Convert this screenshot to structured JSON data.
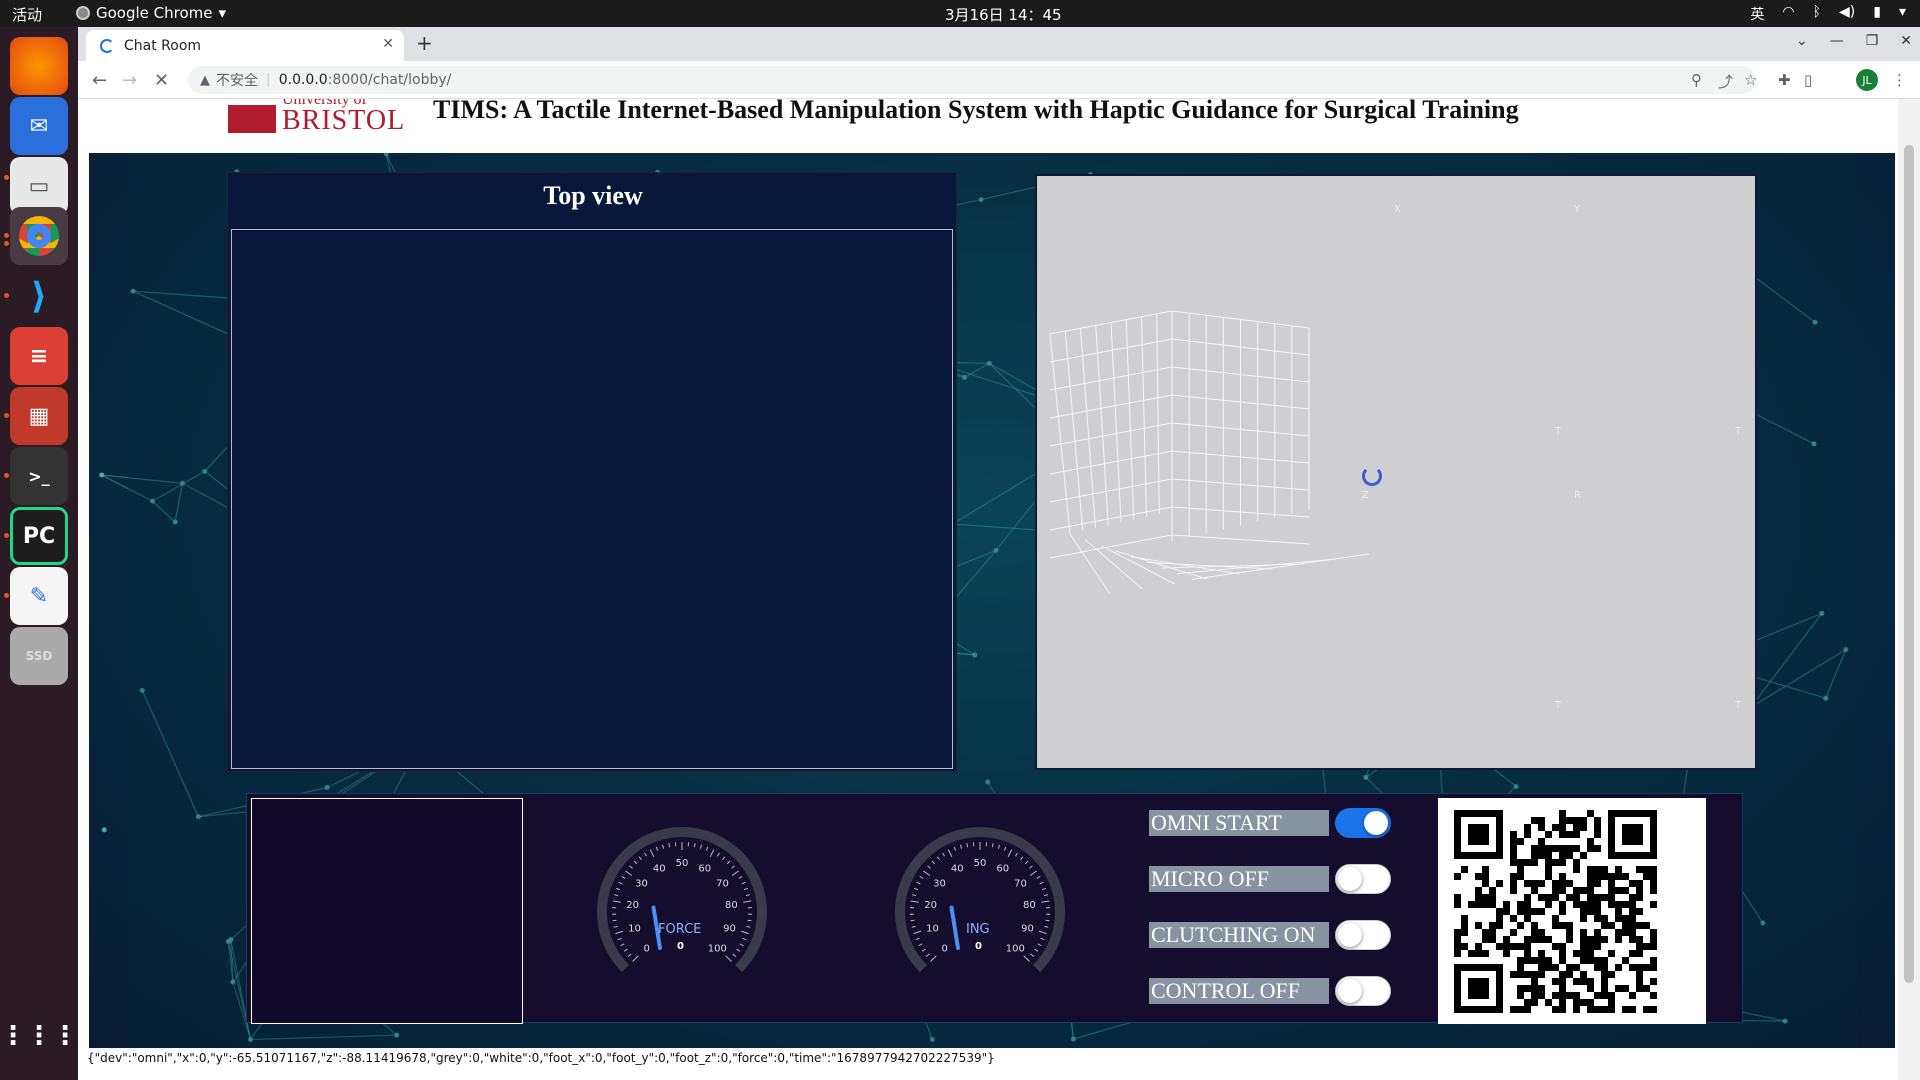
{
  "system": {
    "activities": "活动",
    "app_name": "Google Chrome",
    "clock": "3月16日 14：45",
    "input_method": "英"
  },
  "browser": {
    "tab_title": "Chat Room",
    "security_label": "不安全",
    "url_host": "0.0.0.0",
    "url_rest": ":8000/chat/lobby/",
    "avatar_initials": "JL"
  },
  "page": {
    "logo_top": "University of",
    "logo_name": "BRISTOL",
    "title": "TIMS: A Tactile Internet-Based Manipulation System with Haptic Guidance for Surgical Training",
    "top_view_heading": "Top view",
    "plot_axis_labels": [
      "X",
      "Y",
      "T",
      "T",
      "Z",
      "R",
      "T",
      "T"
    ],
    "gauges": [
      {
        "label": "FORCE",
        "value": "0",
        "ticks": [
          "0",
          "10",
          "20",
          "30",
          "40",
          "50",
          "60",
          "70",
          "80",
          "90",
          "100"
        ],
        "level": 0.32
      },
      {
        "label": "ING",
        "value": "0",
        "ticks": [
          "0",
          "10",
          "20",
          "30",
          "40",
          "50",
          "60",
          "70",
          "80",
          "90",
          "100"
        ],
        "level": 0.32
      }
    ],
    "toggles": [
      {
        "label": "OMNI START",
        "on": true
      },
      {
        "label": "MICRO OFF",
        "on": false
      },
      {
        "label": "CLUTCHING ON",
        "on": false
      },
      {
        "label": "CONTROL OFF",
        "on": false
      }
    ],
    "status_line": "{\"dev\":\"omni\",\"x\":0,\"y\":-65.51071167,\"z\":-88.11419678,\"grey\":0,\"white\":0,\"foot_x\":0,\"foot_y\":0,\"foot_z\":0,\"force\":0,\"time\":\"1678977942702227539\"}"
  },
  "colors": {
    "accent": "#1a73e8",
    "bristol_red": "#b01c2e",
    "panel_bg": "#140d2e",
    "network_line": "#4fd1c5"
  }
}
